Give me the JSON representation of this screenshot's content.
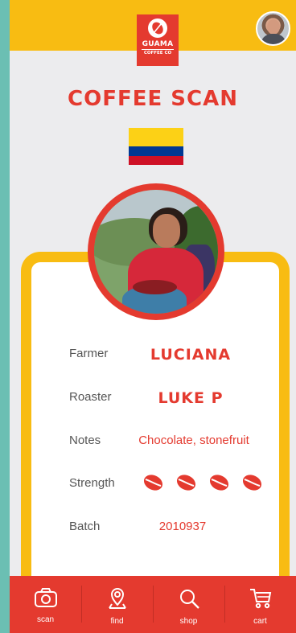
{
  "brand": {
    "name_line1": "GUAMA",
    "name_line2": "COFFEE CO",
    "logo_icon": "coffee-bean-icon"
  },
  "page_title": "COFFEE SCAN",
  "origin_flag": {
    "country": "Colombia",
    "colors": [
      "#fcd116",
      "#003893",
      "#ce1126"
    ]
  },
  "details": {
    "farmer": {
      "label": "Farmer",
      "value": "LUCIANA"
    },
    "roaster": {
      "label": "Roaster",
      "value": "LUKE P"
    },
    "notes": {
      "label": "Notes",
      "value": "Chocolate, stonefruit"
    },
    "strength": {
      "label": "Strength",
      "level": 4,
      "icon": "coffee-bean-icon"
    },
    "batch": {
      "label": "Batch",
      "value": "2010937"
    }
  },
  "nav": [
    {
      "label": "scan",
      "icon": "camera-icon"
    },
    {
      "label": "find",
      "icon": "map-pin-icon"
    },
    {
      "label": "shop",
      "icon": "search-icon"
    },
    {
      "label": "cart",
      "icon": "cart-icon"
    }
  ],
  "colors": {
    "accent": "#e43a2f",
    "header": "#f8bc12",
    "background": "#ececee"
  }
}
